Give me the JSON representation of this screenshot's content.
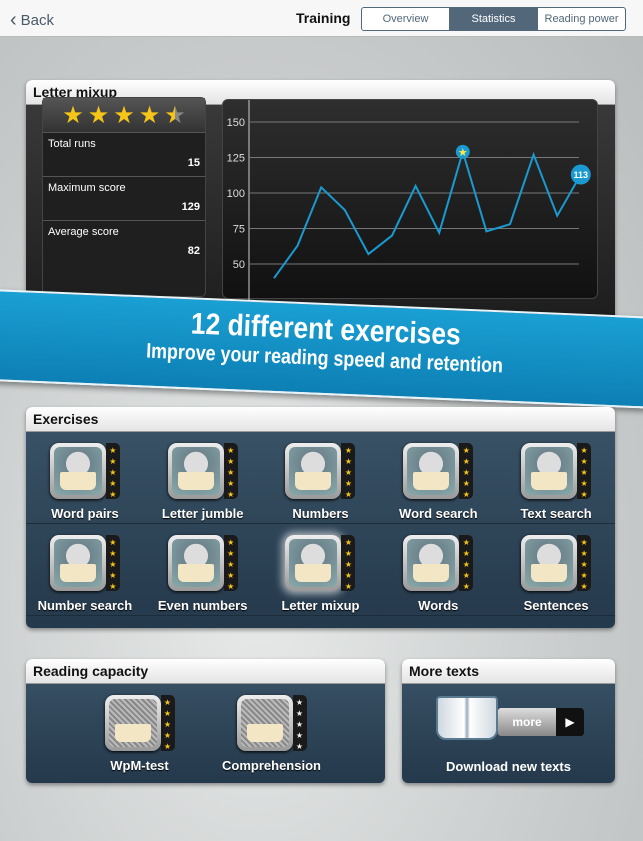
{
  "header": {
    "back_label": "Back",
    "title": "Training",
    "tabs": [
      {
        "label": "Overview"
      },
      {
        "label": "Statistics",
        "selected": true
      },
      {
        "label": "Reading power"
      }
    ]
  },
  "stats_panel": {
    "title": "Letter mixup",
    "rating": 4.5,
    "rating_max": 5,
    "rows": [
      {
        "label": "Total runs",
        "value": "15"
      },
      {
        "label": "Maximum score",
        "value": "129"
      },
      {
        "label": "Average score",
        "value": "82"
      }
    ]
  },
  "chart_data": {
    "type": "line",
    "y_ticks": [
      "150",
      "125",
      "100",
      "75",
      "50"
    ],
    "ylim": [
      25,
      160
    ],
    "grid": true,
    "line_color": "#1a9ad0",
    "values": [
      40,
      63,
      104,
      88,
      57,
      70,
      105,
      72,
      129,
      73,
      78,
      127,
      84,
      113
    ],
    "max_marker": "star",
    "last_label": "113"
  },
  "banner": {
    "line1": "12 different exercises",
    "line2": "Improve your reading speed and retention"
  },
  "exercises": {
    "title": "Exercises",
    "items": [
      {
        "label": "Word pairs",
        "stars": 5
      },
      {
        "label": "Letter jumble",
        "stars": 5
      },
      {
        "label": "Numbers",
        "stars": 5
      },
      {
        "label": "Word search",
        "stars": 5
      },
      {
        "label": "Text search",
        "stars": 5
      },
      {
        "label": "Number search",
        "stars": 5
      },
      {
        "label": "Even numbers",
        "stars": 5
      },
      {
        "label": "Letter mixup",
        "stars": 5,
        "selected": true
      },
      {
        "label": "Words",
        "stars": 5
      },
      {
        "label": "Sentences",
        "stars": 5
      }
    ]
  },
  "reading_capacity": {
    "title": "Reading capacity",
    "items": [
      {
        "label": "WpM-test",
        "stars": 5
      },
      {
        "label": "Comprehension",
        "stars": 0
      }
    ]
  },
  "more_texts": {
    "title": "More texts",
    "button": "more",
    "caption": "Download new texts"
  }
}
